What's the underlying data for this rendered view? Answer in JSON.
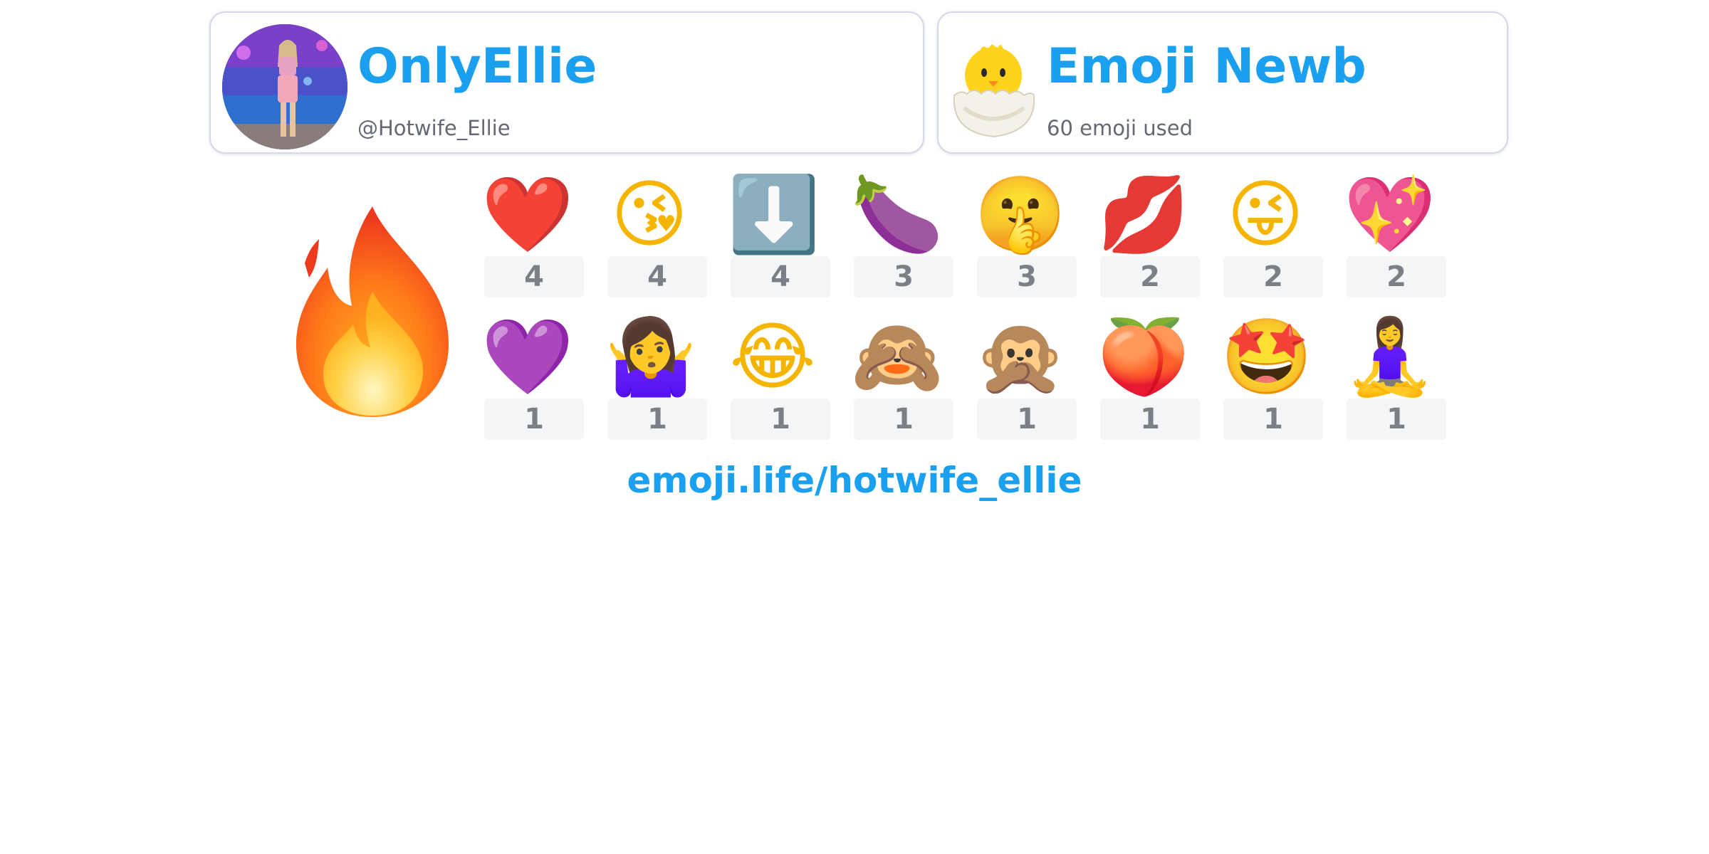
{
  "profile": {
    "name": "OnlyEllie",
    "handle": "@Hotwife_Ellie",
    "avatar": "profile-photo"
  },
  "rank": {
    "title": "Emoji Newb",
    "subtitle": "60 emoji used",
    "icon": "hatching-chick-icon"
  },
  "top_emoji": {
    "icon": "fire-icon",
    "glyph": "🔥"
  },
  "emoji_stats": [
    {
      "glyph": "❤️",
      "icon": "red-heart-icon",
      "count": "4",
      "color": "#e0272b"
    },
    {
      "glyph": "😘",
      "icon": "face-blowing-kiss-icon",
      "count": "4",
      "color": "#f5b400"
    },
    {
      "glyph": "⬇️",
      "icon": "down-arrow-icon",
      "count": "4",
      "color": "#5e7ea6"
    },
    {
      "glyph": "🍆",
      "icon": "eggplant-icon",
      "count": "3",
      "color": "#6b3a8e"
    },
    {
      "glyph": "🤫",
      "icon": "shushing-face-icon",
      "count": "3",
      "color": "#f5b400"
    },
    {
      "glyph": "💋",
      "icon": "kiss-mark-icon",
      "count": "2",
      "color": "#d8232a"
    },
    {
      "glyph": "😜",
      "icon": "winking-face-with-tongue-icon",
      "count": "2",
      "color": "#f5b400"
    },
    {
      "glyph": "💖",
      "icon": "sparkling-heart-icon",
      "count": "2",
      "color": "#ef3fa4"
    },
    {
      "glyph": "💜",
      "icon": "purple-heart-icon",
      "count": "1",
      "color": "#9d4df2"
    },
    {
      "glyph": "🤷‍♀️",
      "icon": "woman-shrugging-icon",
      "count": "1",
      "color": "#8a3fc0"
    },
    {
      "glyph": "😂",
      "icon": "face-with-tears-of-joy-icon",
      "count": "1",
      "color": "#f5b400"
    },
    {
      "glyph": "🙈",
      "icon": "see-no-evil-monkey-icon",
      "count": "1",
      "color": "#a06a3e"
    },
    {
      "glyph": "🙊",
      "icon": "speak-no-evil-monkey-icon",
      "count": "1",
      "color": "#a06a3e"
    },
    {
      "glyph": "🍑",
      "icon": "peach-icon",
      "count": "1",
      "color": "#f28a55"
    },
    {
      "glyph": "🤩",
      "icon": "star-struck-icon",
      "count": "1",
      "color": "#f5b400"
    },
    {
      "glyph": "🧘‍♀️",
      "icon": "woman-in-lotus-position-icon",
      "count": "1",
      "color": "#f5c12a"
    }
  ],
  "footer": {
    "link": "emoji.life/hotwife_ellie"
  }
}
